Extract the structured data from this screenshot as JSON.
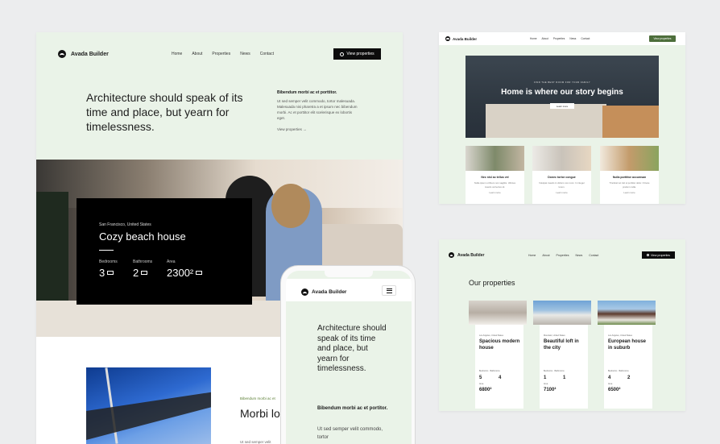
{
  "main": {
    "brand": "Avada Builder",
    "nav": [
      "Home",
      "About",
      "Properties",
      "News",
      "Contact"
    ],
    "cta": "View properties",
    "hero_title": "Architecture should speak of its time and place, but yearn for timelessness.",
    "side_heading": "Bibendum morbi ac et porttitor.",
    "side_text": "Ut sed semper velit commodo, tortor malesuada. Malesuada nisi pharetra a et ipsum nec bibendum morbi. Ac et porttitor elit scelerisque ex lobortis eget.",
    "side_link": "View properties →",
    "listing": {
      "location": "San Francisco, United States",
      "name": "Cozy beach house",
      "bedrooms_label": "Bedrooms",
      "bedrooms": "3",
      "bathrooms_label": "Bathrooms",
      "bathrooms": "2",
      "area_label": "Area",
      "area": "2300²"
    },
    "lower_kicker": "Bibendum morbi ac et",
    "lower_title": "Morbi lo ac eget",
    "lower_text": "Ut sed semper velit"
  },
  "top_right": {
    "brand": "Avada Builder",
    "nav": [
      "Home",
      "About",
      "Properties",
      "News",
      "Contact"
    ],
    "cta": "View properties",
    "tagline": "FIND THE BEST ROOM FOR YOUR FAMILY",
    "hero_title": "Home is where our story begins",
    "hero_button": "Learn more",
    "columns": [
      {
        "title": "Nec nisl ac tellus vel",
        "text": "Nulla ipsum ut libero non sagittis. Ultrices mauris vel lectus sit.",
        "link": "Learn more"
      },
      {
        "title": "Donec tortor congue",
        "text": "Volutpat mauris in dictum non nunc. In integer lorem.",
        "link": "Learn more"
      },
      {
        "title": "Nulla porttitor accumsan",
        "text": "Tincidunt at nisl ut porttitor dolor. Ornare pretium nulla.",
        "link": "Learn more"
      }
    ]
  },
  "bottom_right": {
    "brand": "Avada Builder",
    "nav": [
      "Home",
      "About",
      "Properties",
      "News",
      "Contact"
    ],
    "cta": "View properties",
    "heading": "Our properties",
    "properties": [
      {
        "location": "Los Angeles, United States",
        "name": "Spacious modern house",
        "bedrooms": "5",
        "bathrooms": "4",
        "area": "6800²"
      },
      {
        "location": "Mountain, United States",
        "name": "Beautiful loft in the city",
        "bedrooms": "1",
        "bathrooms": "1",
        "area": "7100²"
      },
      {
        "location": "Los Angeles, United States",
        "name": "European house in suburb",
        "bedrooms": "4",
        "bathrooms": "2",
        "area": "6500²"
      }
    ],
    "labels": {
      "bedrooms": "Bedrooms",
      "bathrooms": "Bathrooms",
      "area": "Area"
    }
  },
  "phone": {
    "brand": "Avada Builder",
    "hero_title": "Architecture should speak of its time and place, but yearn for timelessness.",
    "sub_heading": "Bibendum morbi ac et portitor.",
    "sub_text": "Ut sed semper velit commodo, tortor"
  },
  "colors": {
    "mint": "#eaf3e8",
    "dark": "#0c0c0c",
    "accent_green": "#4d6e3b",
    "page_bg": "#ecedee"
  }
}
